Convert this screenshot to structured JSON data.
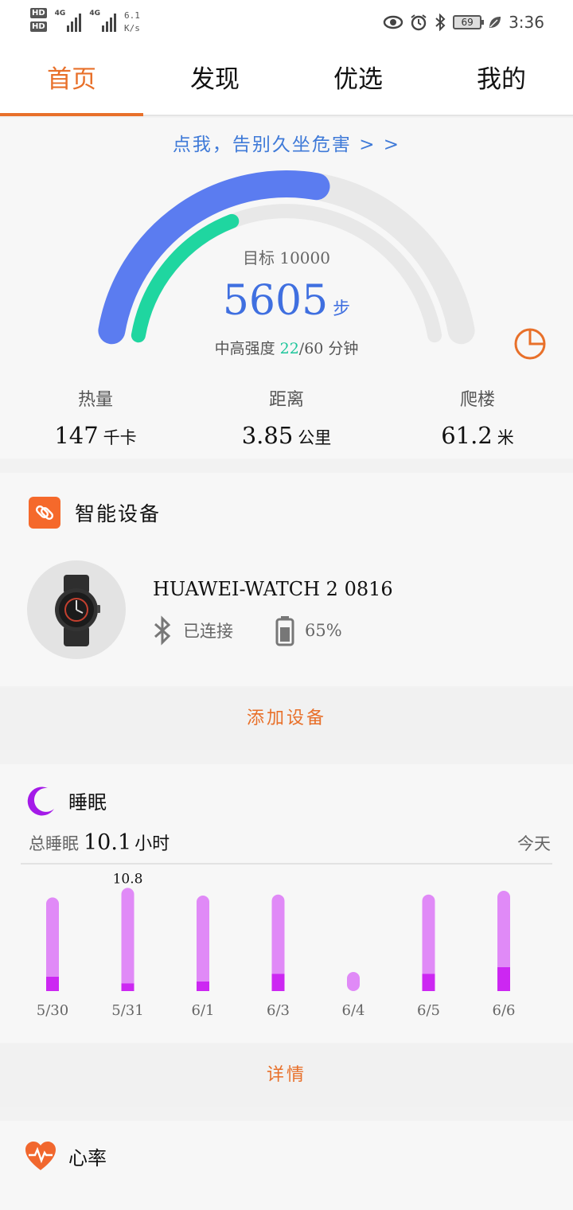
{
  "status_bar": {
    "hd1": "HD",
    "hd2": "HD",
    "net1": "4G",
    "net2": "4G",
    "speed_value": "6.1",
    "speed_unit": "K/s",
    "battery": "69",
    "time": "3:36"
  },
  "tabs": [
    {
      "label": "首页",
      "active": true
    },
    {
      "label": "发现",
      "active": false
    },
    {
      "label": "优选",
      "active": false
    },
    {
      "label": "我的",
      "active": false
    }
  ],
  "steps": {
    "promo": "点我，告别久坐危害 > >",
    "goal_text": "目标 10000",
    "goal": 10000,
    "count": "5605",
    "count_value": 5605,
    "unit": "步",
    "intensity_prefix": "中高强度 ",
    "intensity_done": "22",
    "intensity_suffix": "/60 分钟",
    "intensity_ratio": 0.3667,
    "colors": {
      "steps": "#5b7cf0",
      "intensity": "#1fd6a0",
      "track": "#e8e8e8"
    }
  },
  "stats": [
    {
      "label": "热量",
      "value": "147",
      "unit": "千卡"
    },
    {
      "label": "距离",
      "value": "3.85",
      "unit": "公里"
    },
    {
      "label": "爬楼",
      "value": "61.2",
      "unit": "米"
    }
  ],
  "device": {
    "title": "智能设备",
    "name": "HUAWEI-WATCH 2 0816",
    "connection": "已连接",
    "battery": "65%",
    "add_label": "添加设备"
  },
  "sleep": {
    "title": "睡眠",
    "total_label": "总睡眠",
    "total_value": "10.1",
    "total_unit": "小时",
    "period": "今天",
    "detail_label": "详情",
    "colors": {
      "light": "#e08af7",
      "deep": "#cc27f2"
    }
  },
  "chart_data": {
    "type": "bar",
    "categories": [
      "5/30",
      "5/31",
      "6/1",
      "6/3",
      "6/4",
      "6/5",
      "6/6"
    ],
    "series": [
      {
        "values": [
          9.8,
          10.8,
          10.0,
          10.1,
          2.0,
          10.1,
          10.5
        ]
      },
      {
        "values": [
          1.5,
          0.8,
          1.0,
          1.8,
          0,
          1.8,
          2.5
        ]
      }
    ],
    "data_labels": [
      {
        "category": "5/31",
        "text": "10.8"
      }
    ],
    "ylim": [
      0,
      11
    ]
  },
  "heart": {
    "title": "心率"
  }
}
